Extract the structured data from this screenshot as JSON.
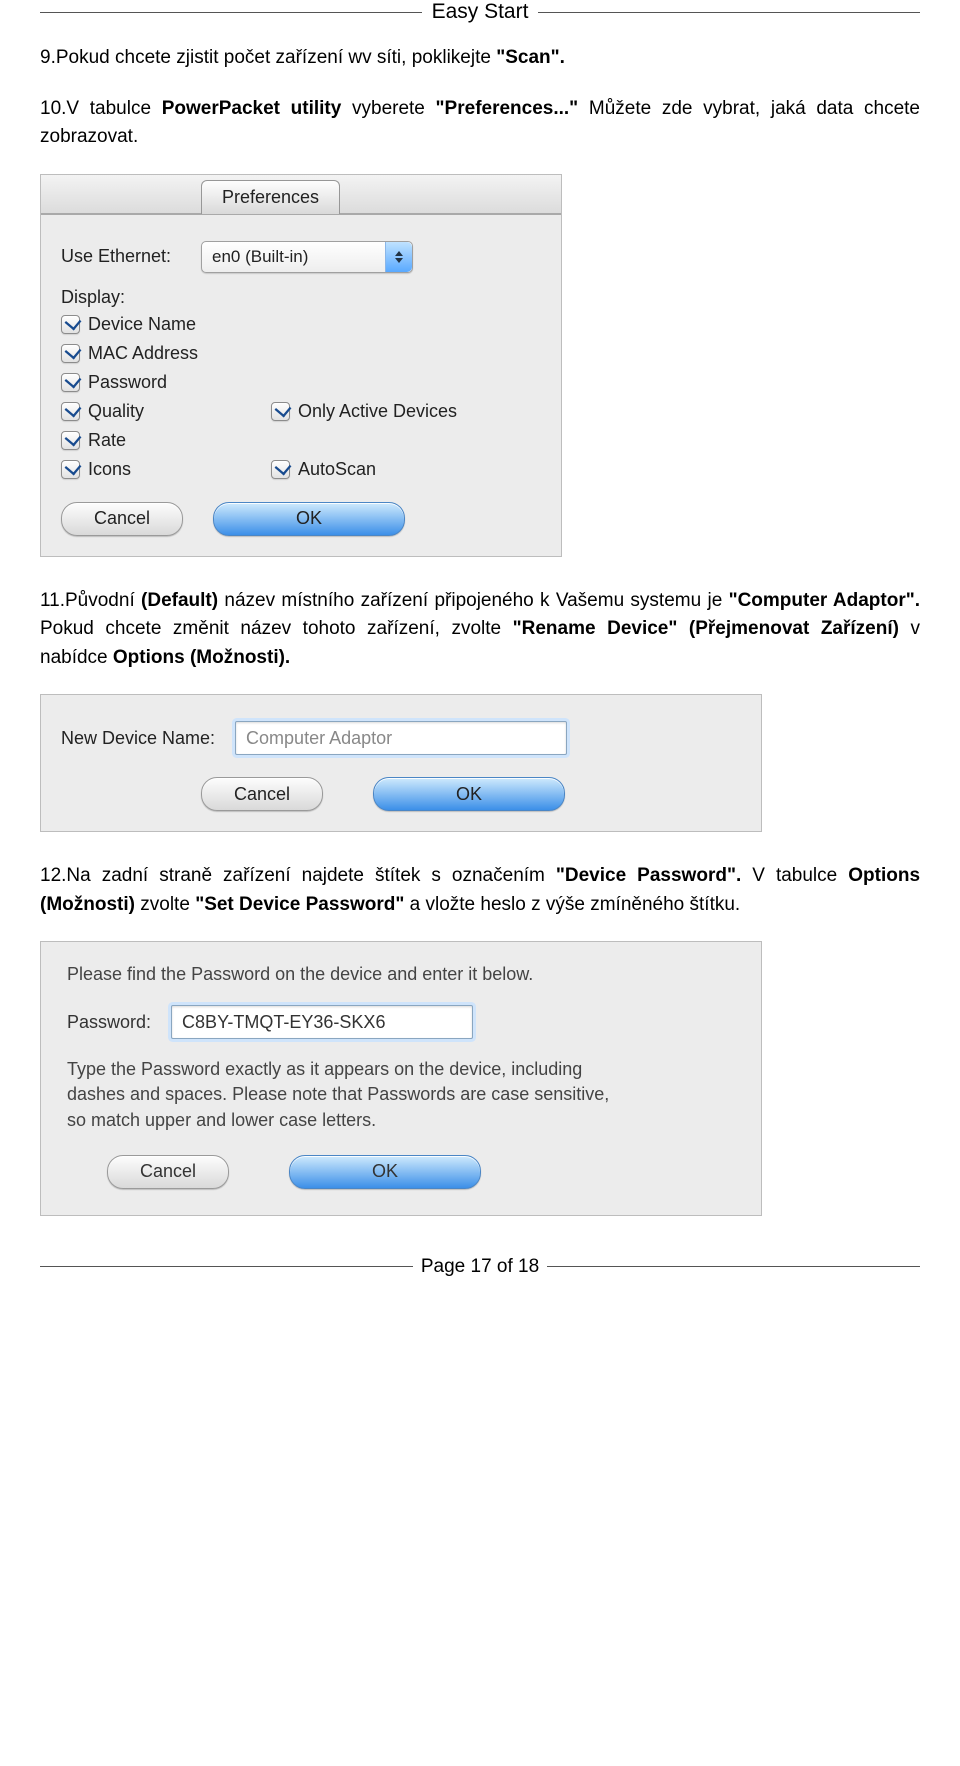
{
  "header": {
    "title": "Easy Start"
  },
  "para9": {
    "pre": "9.Pokud chcete zjistit počet zařízení wv síti, poklikejte ",
    "strong": "\"Scan\".",
    "post": ""
  },
  "para10": {
    "pre1": "10.V tabulce ",
    "s1": "PowerPacket utility",
    "mid1": " vyberete ",
    "s2": "\"Preferences...\"",
    "post": " Můžete zde vybrat, jaká data chcete zobrazovat."
  },
  "prefs": {
    "tab": "Preferences",
    "use_ethernet_label": "Use Ethernet:",
    "iface": "en0 (Built-in)",
    "display": "Display:",
    "checks": {
      "device_name": "Device Name",
      "mac": "MAC Address",
      "password": "Password",
      "quality": "Quality",
      "rate": "Rate",
      "icons": "Icons",
      "only_active": "Only Active Devices",
      "autoscan": "AutoScan"
    },
    "cancel": "Cancel",
    "ok": "OK"
  },
  "para11": {
    "pre": "11.Původní ",
    "s1": "(Default)",
    "mid1": " název místního zařízení připojeného k Vašemu systemu je ",
    "s2": "\"Computer Adaptor\".",
    "mid2": " Pokud chcete změnit název tohoto zařízení, zvolte ",
    "s3": "\"Rename Device\" (Přejmenovat Zařízení)",
    "mid3": " v nabídce ",
    "s4": "Options (Možnosti).",
    "post": ""
  },
  "rename": {
    "label": "New Device Name:",
    "value": "Computer Adaptor",
    "cancel": "Cancel",
    "ok": "OK"
  },
  "para12": {
    "pre": "12.Na zadní straně zařízení najdete štítek s označením ",
    "s1": "\"Device Password\".",
    "mid1": " V tabulce ",
    "s2": "Options (Možnosti)",
    "mid2": " zvolte ",
    "s3": "\"Set Device Password\"",
    "post": " a vložte heslo z výše zmíněného štítku."
  },
  "pwd": {
    "msg1": "Please find the Password on the device and enter it below.",
    "label": "Password:",
    "value": "C8BY-TMQT-EY36-SKX6",
    "msg2": "Type the Password exactly as it appears on the device,  including dashes and spaces.  Please note that Passwords are case sensitive, so match upper and lower case letters.",
    "cancel": "Cancel",
    "ok": "OK"
  },
  "footer": {
    "page": "Page 17 of 18"
  }
}
